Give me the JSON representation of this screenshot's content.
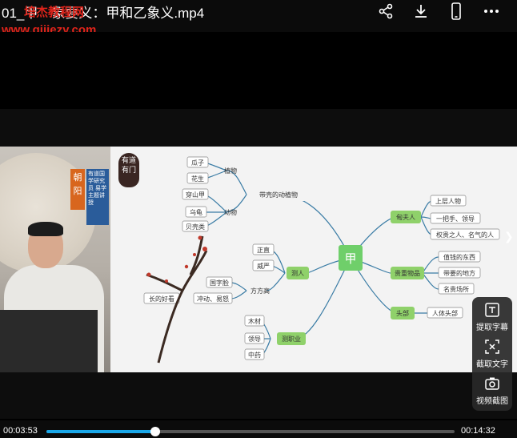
{
  "header": {
    "title": "01_甲　象要义：甲和乙象义.mp4",
    "watermark_name": "培杰教程网",
    "watermark_url": "www.qijiezy.com",
    "icons": [
      "share-icon",
      "download-icon",
      "phone-icon",
      "more-icon"
    ]
  },
  "presenter": {
    "name_card": "朝阳",
    "title_card": "有道国学研究员 易学主题讲授"
  },
  "slide": {
    "seal_text": "有道 有门",
    "center": "甲",
    "branches": {
      "animals_plants": "带壳的动植物",
      "plants": "植物",
      "animals": "动物",
      "plant_items": [
        "瓜子",
        "花生"
      ],
      "animal_items": [
        "穿山甲",
        "乌龟",
        "贝壳类"
      ],
      "measure_person": "测人",
      "person_items": [
        "正直",
        "威严"
      ],
      "square_face": "方方高",
      "square_face_items": [
        "国字脸",
        "冲动、易怒"
      ],
      "good_looking": "长的好看",
      "measure_job": "测职业",
      "job_items": [
        "木材",
        "领导",
        "中药"
      ],
      "for_person": "甸夫人",
      "for_person_items": [
        "上层人物",
        "一把手、领导",
        "权贵之人、名气的人"
      ],
      "valuables": "贵重物品",
      "valuables_items": [
        "值钱的东西",
        "带要的地方",
        "名贵场所"
      ],
      "head": "头部",
      "head_items": [
        "人体头部"
      ]
    }
  },
  "sidetools": {
    "extract_subtitles": "提取字幕",
    "extract_text": "截取文字",
    "video_screenshot": "视频截图"
  },
  "player": {
    "current_time": "00:03:53",
    "total_time": "00:14:32",
    "progress": 0.267
  },
  "colors": {
    "accent": "#1aa7e8",
    "node_green": "#8fd16a",
    "watermark": "#e0241b"
  }
}
